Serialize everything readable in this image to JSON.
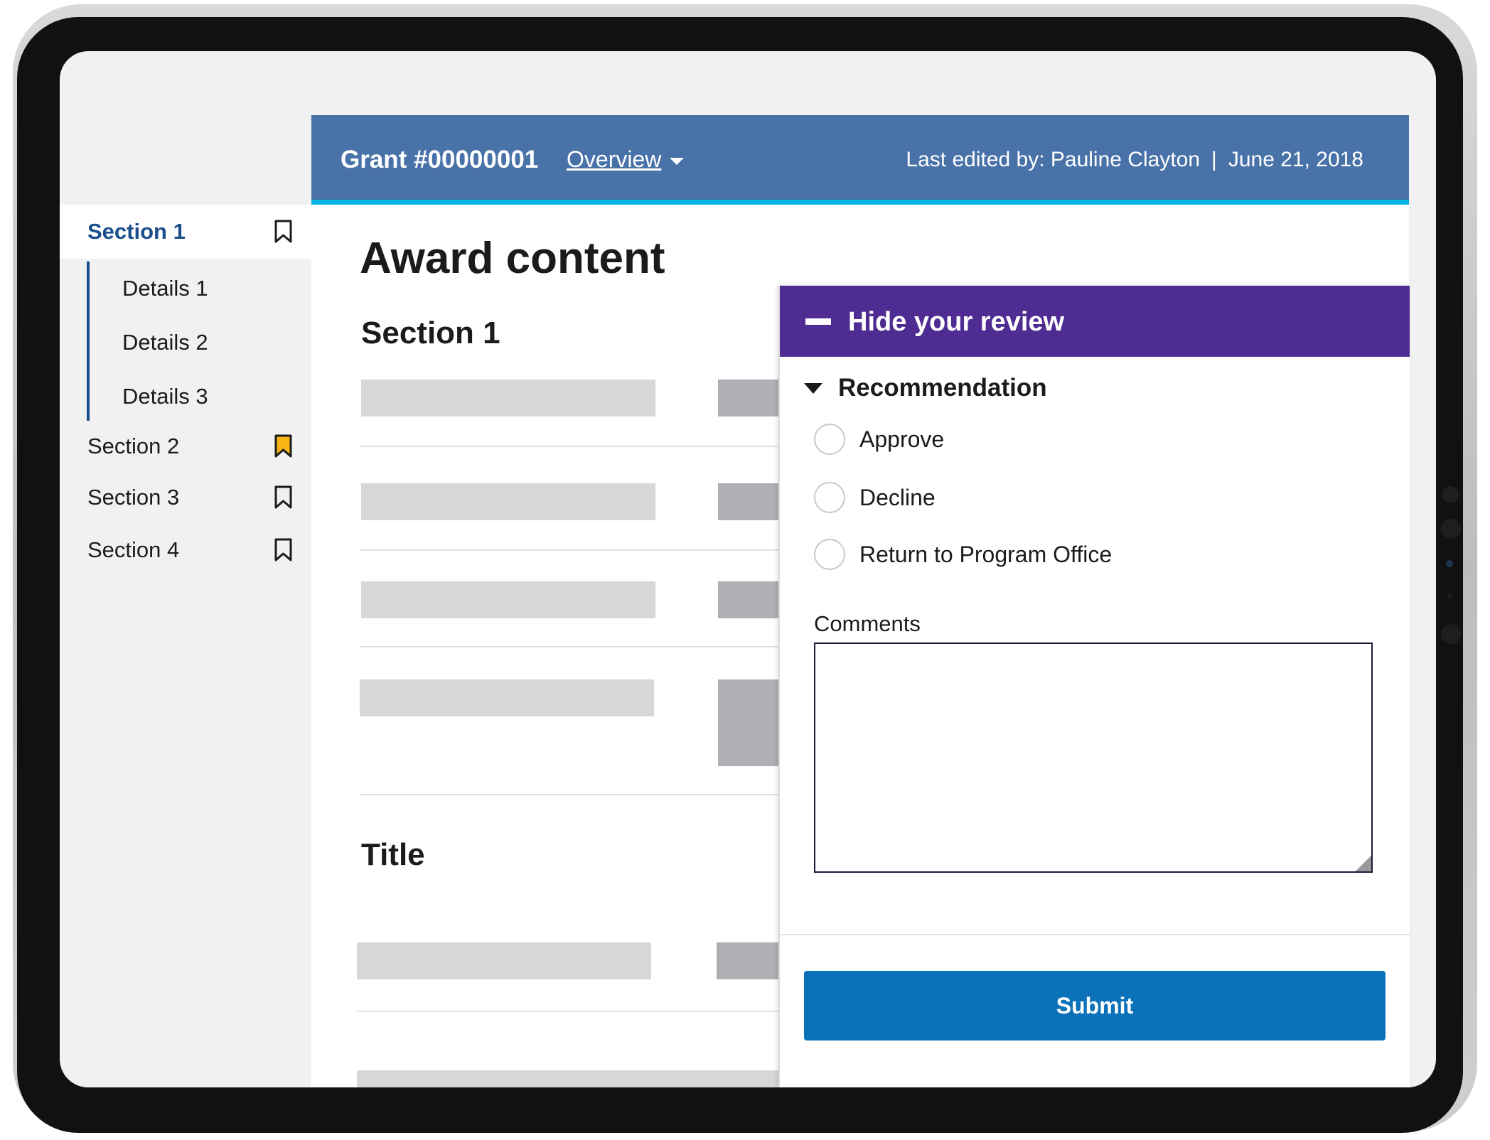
{
  "header": {
    "grant_title": "Grant #00000001",
    "overview_label": "Overview",
    "last_edited_by": "Last edited by: Pauline Clayton",
    "separator": "|",
    "date": "June 21, 2018"
  },
  "sidebar": {
    "sections": [
      {
        "label": "Section 1",
        "active": true,
        "bookmark": "bookmark-outline-icon"
      },
      {
        "label": "Section 2",
        "active": false,
        "bookmark": "bookmark-filled-icon"
      },
      {
        "label": "Section 3",
        "active": false,
        "bookmark": "bookmark-outline-icon"
      },
      {
        "label": "Section 4",
        "active": false,
        "bookmark": "bookmark-outline-icon"
      }
    ],
    "details": [
      "Details 1",
      "Details 2",
      "Details 3"
    ]
  },
  "main": {
    "heading": "Award content",
    "section_heading": "Section 1",
    "title_heading": "Title"
  },
  "review": {
    "toggle_label": "Hide your review",
    "recommendation_label": "Recommendation",
    "options": [
      "Approve",
      "Decline",
      "Return to Program Office"
    ],
    "comments_label": "Comments",
    "comments_value": "",
    "submit_label": "Submit"
  },
  "colors": {
    "header_bg": "#4872a8",
    "header_accent": "#00b5e2",
    "review_header_bg": "#4f2c92",
    "active_nav": "#1a4f8b",
    "bookmark_highlight": "#f9b515",
    "submit_bg": "#0b72b9"
  }
}
